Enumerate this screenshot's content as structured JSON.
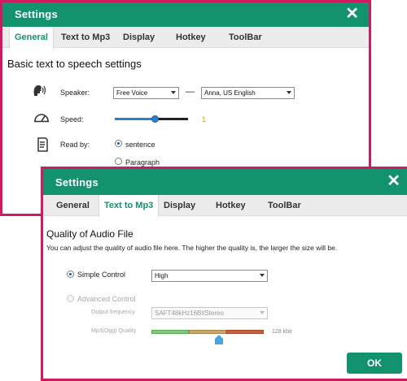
{
  "window1": {
    "title": "Settings",
    "close": "✕",
    "tabs": [
      "General",
      "Text to Mp3",
      "Display",
      "Hotkey",
      "ToolBar"
    ],
    "active_tab": "General",
    "heading": "Basic text to speech settings",
    "speaker_label": "Speaker:",
    "speaker_engine": "Free Voice",
    "dash": "—",
    "speaker_voice": "Anna, US English",
    "speed_label": "Speed:",
    "speed_value": "1",
    "speed_level": 0.55,
    "readby_label": "Read by:",
    "readby_option1": "sentence",
    "readby_option2": "Paragraph",
    "readby_selected": "sentence"
  },
  "window2": {
    "title": "Settings",
    "close": "✕",
    "tabs": [
      "General",
      "Text to Mp3",
      "Display",
      "Hotkey",
      "ToolBar"
    ],
    "active_tab": "Text to Mp3",
    "heading": "Quality of Audio File",
    "description": "You can adjust the quality of audio file here. The higher the quality  is, the larger the size will be.",
    "simple_control_label": "Simple Control",
    "simple_quality": "High",
    "advanced_control_label": "Advanced Control",
    "output_frequency_label": "Output frequency",
    "output_frequency_value": "SAFT48kHz16BitStereo",
    "mp3_quality_label": "Mp3(Ogg) Quality",
    "mp3_quality_value": "128 kbit",
    "mp3_quality_level": 0.6,
    "ok_label": "OK"
  },
  "colors": {
    "accent": "#13936d",
    "frame": "#d21a63",
    "link_tab": "#13936d"
  },
  "icons": {
    "speaker": "speaking-head-icon",
    "speed": "speedometer-icon",
    "readby": "document-icon"
  }
}
